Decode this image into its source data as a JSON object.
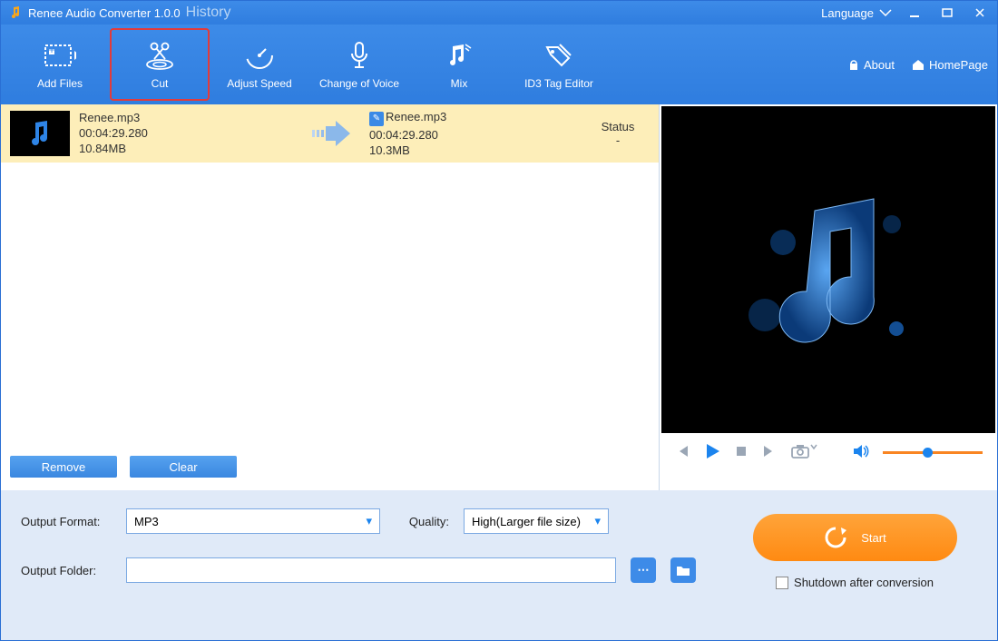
{
  "titlebar": {
    "title": "Renee Audio Converter 1.0.0",
    "history": "History",
    "language": "Language"
  },
  "toolbar": {
    "items": [
      {
        "label": "Add Files"
      },
      {
        "label": "Cut"
      },
      {
        "label": "Adjust Speed"
      },
      {
        "label": "Change of Voice"
      },
      {
        "label": "Mix"
      },
      {
        "label": "ID3 Tag Editor"
      }
    ],
    "about": "About",
    "homepage": "HomePage"
  },
  "file": {
    "src_name": "Renee.mp3",
    "src_duration": "00:04:29.280",
    "src_size": "10.84MB",
    "dst_name": "Renee.mp3",
    "dst_duration": "00:04:29.280",
    "dst_size": "10.3MB",
    "status_label": "Status",
    "status_value": "-"
  },
  "list_buttons": {
    "remove": "Remove",
    "clear": "Clear"
  },
  "settings": {
    "output_format_label": "Output Format:",
    "output_format_value": "MP3",
    "quality_label": "Quality:",
    "quality_value": "High(Larger file size)",
    "output_folder_label": "Output Folder:",
    "output_folder_value": ""
  },
  "actions": {
    "start": "Start",
    "shutdown": "Shutdown after conversion"
  }
}
